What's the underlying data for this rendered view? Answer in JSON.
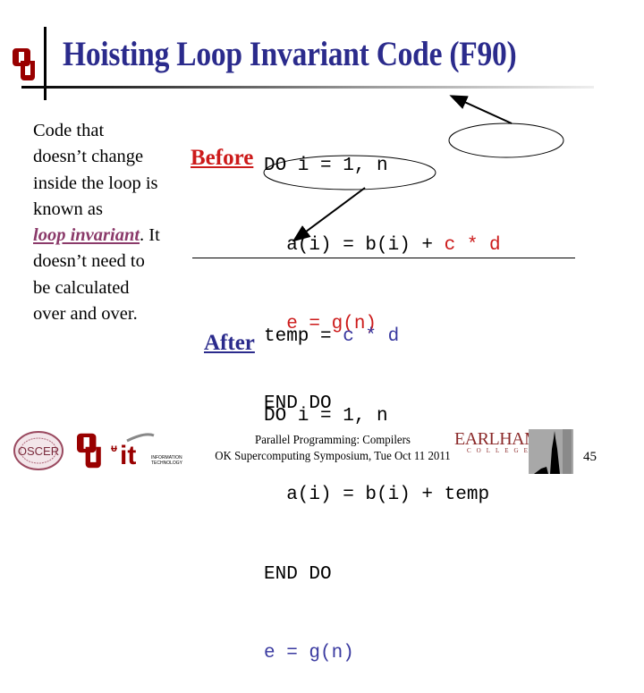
{
  "header": {
    "title": "Hoisting Loop Invariant Code (F90)",
    "logo": "ou-logo-icon"
  },
  "description": {
    "lines": [
      "Code that",
      "doesn’t change",
      "inside the loop is",
      "known as"
    ],
    "keyword": "loop invariant",
    "after_keyword": ". It",
    "rest_lines": [
      "doesn’t need to",
      "be calculated",
      "over and over."
    ]
  },
  "before": {
    "label": "Before",
    "line1": "DO i = 1, n",
    "line2_prefix": "  a(i) = b(i) + ",
    "line2_hoisted": "c * d",
    "line3": "e = g(n)",
    "line4": "END DO"
  },
  "after": {
    "label": "After",
    "line1_prefix": "temp = ",
    "line1_hoisted": "c * d",
    "line2": "DO i = 1, n",
    "line3": "  a(i) = b(i) + temp",
    "line4": "END DO",
    "line5": "e = g(n)"
  },
  "footer": {
    "line1": "Parallel Programming: Compilers",
    "line2": "OK Supercomputing Symposium, Tue Oct 11 2011",
    "page_number": "45",
    "logos": [
      "oscer-logo-icon",
      "ou-logo-icon",
      "ou-it-logo-icon",
      "earlham-college-logo-icon",
      "tower-photo-icon"
    ],
    "earlham_text": "EARLHAM",
    "college_text": "COLLEGE",
    "oscer_text": "OSCER",
    "it_text": "it",
    "it_sub": "INFORMATION TECHNOLOGY"
  },
  "colors": {
    "title": "#2b2b8c",
    "highlight_red": "#cc1a1a",
    "highlight_blue": "#3a3aa0",
    "keyword": "#8b3a6a",
    "ou_crimson": "#990000"
  }
}
